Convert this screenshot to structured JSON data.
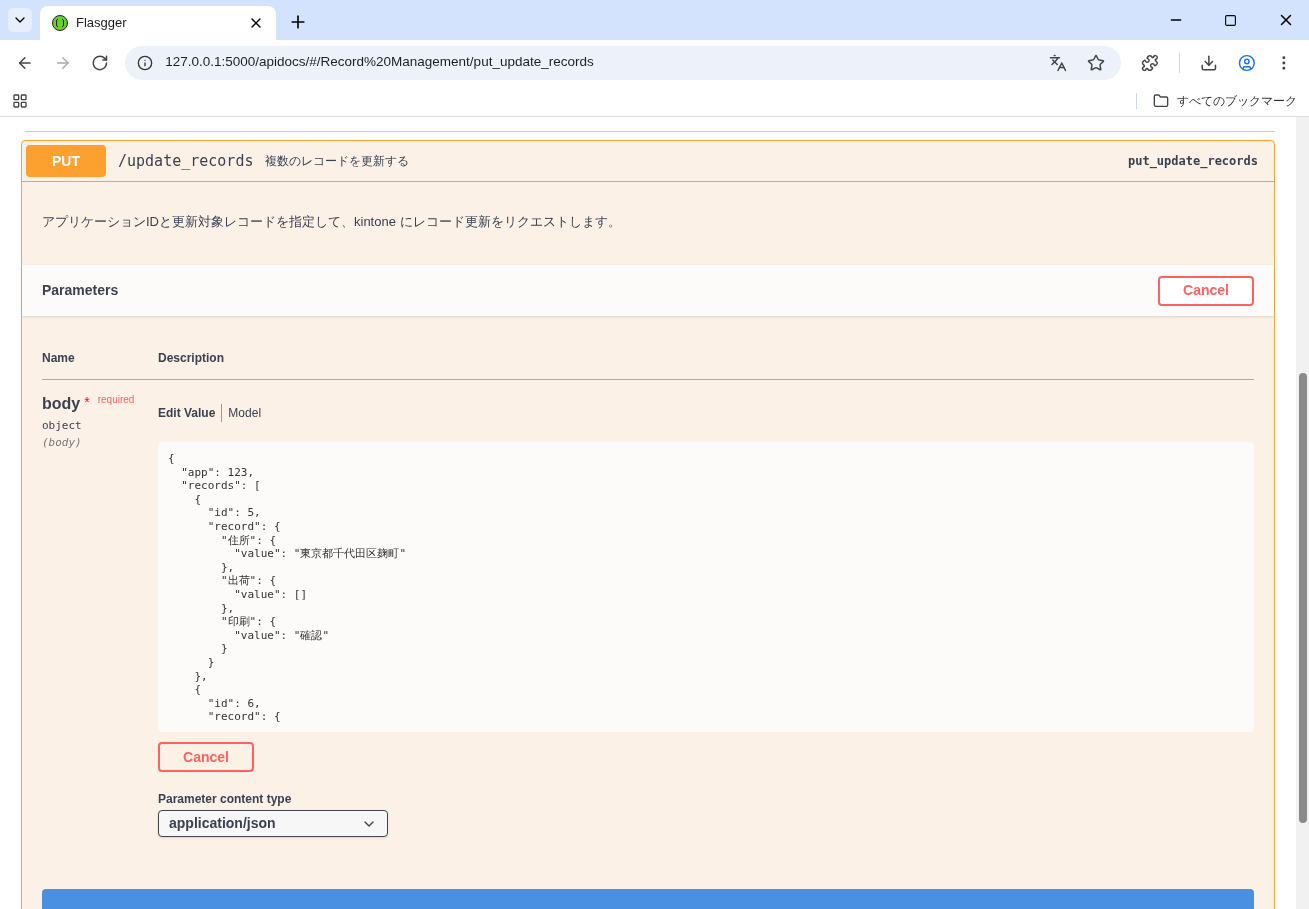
{
  "browser": {
    "tab_title": "Flasgger",
    "url": "127.0.0.1:5000/apidocs/#/Record%20Management/put_update_records",
    "bookmarks_label": "すべてのブックマーク"
  },
  "operation": {
    "method": "PUT",
    "path": "/update_records",
    "summary": "複数のレコードを更新する",
    "operation_id": "put_update_records",
    "description": "アプリケーションIDと更新対象レコードを指定して、kintone にレコード更新をリクエストします。"
  },
  "parameters": {
    "title": "Parameters",
    "cancel_label": "Cancel"
  },
  "table": {
    "columns": [
      "Name",
      "Description"
    ],
    "param": {
      "name": "body",
      "required_mark": "*",
      "required_label": "required",
      "type": "object",
      "in": "(body)"
    },
    "tabs": [
      {
        "label": "Edit Value",
        "selected": true
      },
      {
        "label": "Model",
        "selected": false
      }
    ],
    "code_lines": [
      "{",
      "  \"app\": 123,",
      "  \"records\": [",
      "    {",
      "      \"id\": 5,",
      "      \"record\": {",
      "        \"住所\": {",
      "          \"value\": \"東京都千代田区麹町\"",
      "        },",
      "        \"出荷\": {",
      "          \"value\": []",
      "        },",
      "        \"印刷\": {",
      "          \"value\": \"確認\"",
      "        }",
      "      }",
      "    },",
      "    {",
      "      \"id\": 6,",
      "      \"record\": {"
    ]
  },
  "cancel_label": "Cancel",
  "content_type": {
    "label": "Parameter content type",
    "value": "application/json"
  }
}
